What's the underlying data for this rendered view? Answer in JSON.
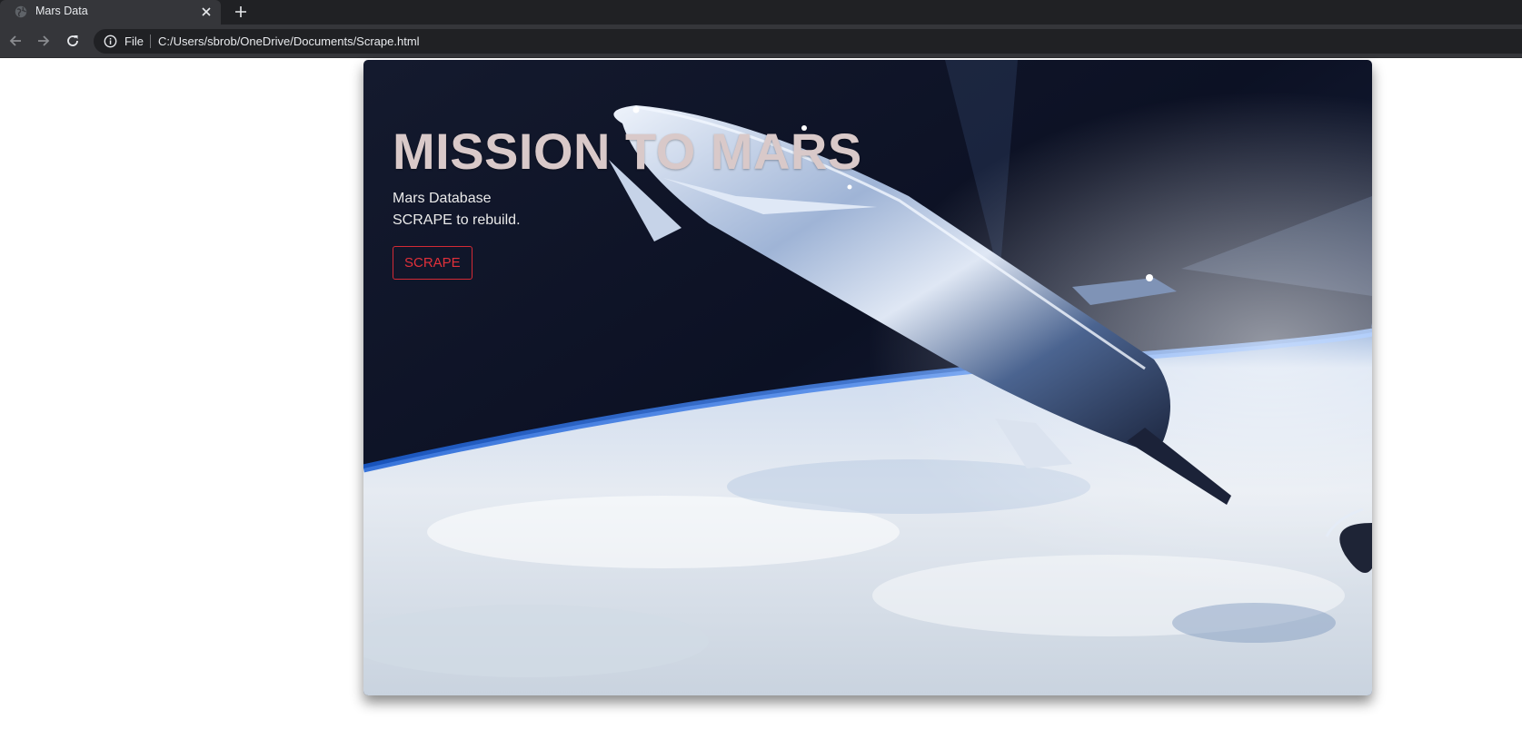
{
  "browser": {
    "tab_title": "Mars Data",
    "scheme_label": "File",
    "url": "C:/Users/sbrob/OneDrive/Documents/Scrape.html"
  },
  "jumbotron": {
    "title": "MISSION TO MARS",
    "line1": "Mars Database",
    "line2": "SCRAPE to rebuild.",
    "button_label": "SCRAPE"
  },
  "colors": {
    "chrome_dark": "#202124",
    "chrome_toolbar": "#35363a",
    "title_color": "#d9c9c9",
    "button_accent": "#e0303a"
  },
  "icons": {
    "favicon": "globe-icon",
    "tab_close": "close-icon",
    "new_tab": "plus-icon",
    "back": "back-arrow-icon",
    "forward": "forward-arrow-icon",
    "reload": "reload-icon",
    "site_info": "info-icon"
  }
}
